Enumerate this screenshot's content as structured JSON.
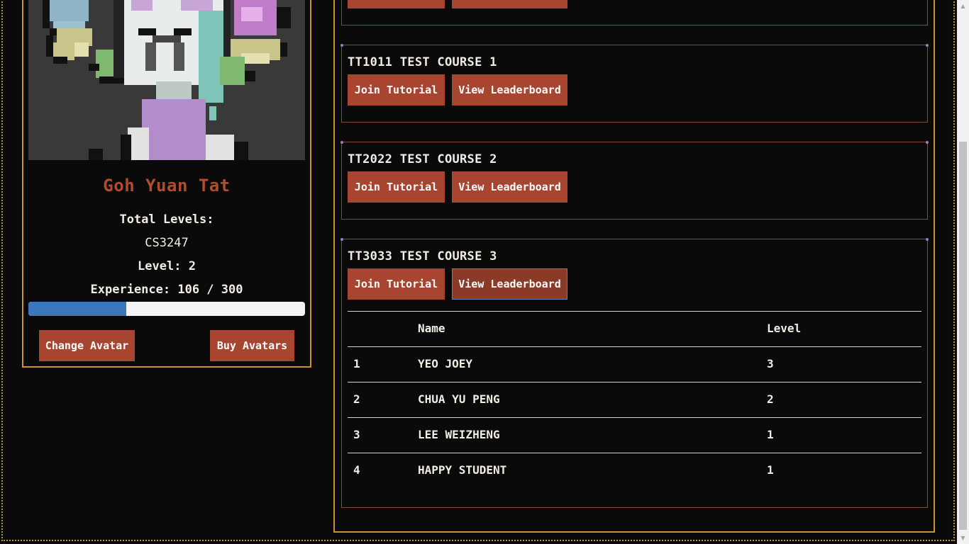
{
  "profile": {
    "name": "Goh Yuan Tat",
    "total_levels_label": "Total Levels:",
    "course_code": "CS3247",
    "level_text": "Level: 2",
    "experience_text": "Experience: 106 / 300",
    "experience_current": 106,
    "experience_max": 300,
    "change_avatar_label": "Change Avatar",
    "buy_avatars_label": "Buy Avatars"
  },
  "courses": [
    {
      "title": "TT1011 TEST COURSE 1",
      "join_label": "Join Tutorial",
      "leaderboard_label": "View Leaderboard"
    },
    {
      "title": "TT2022 TEST COURSE 2",
      "join_label": "Join Tutorial",
      "leaderboard_label": "View Leaderboard"
    },
    {
      "title": "TT3033 TEST COURSE 3",
      "join_label": "Join Tutorial",
      "leaderboard_label": "View Leaderboard"
    }
  ],
  "leaderboard": {
    "headers": {
      "rank": "",
      "name": "Name",
      "level": "Level"
    },
    "rows": [
      {
        "rank": "1",
        "name": "YEO JOEY",
        "level": "3"
      },
      {
        "rank": "2",
        "name": "CHUA YU PENG",
        "level": "2"
      },
      {
        "rank": "3",
        "name": "LEE WEIZHENG",
        "level": "1"
      },
      {
        "rank": "4",
        "name": "HAPPY STUDENT",
        "level": "1"
      }
    ]
  },
  "colors": {
    "accent_button": "#a84530",
    "frame_gold": "#c9952a",
    "name_red": "#b24c2e",
    "xp_blue": "#3a77bd"
  }
}
